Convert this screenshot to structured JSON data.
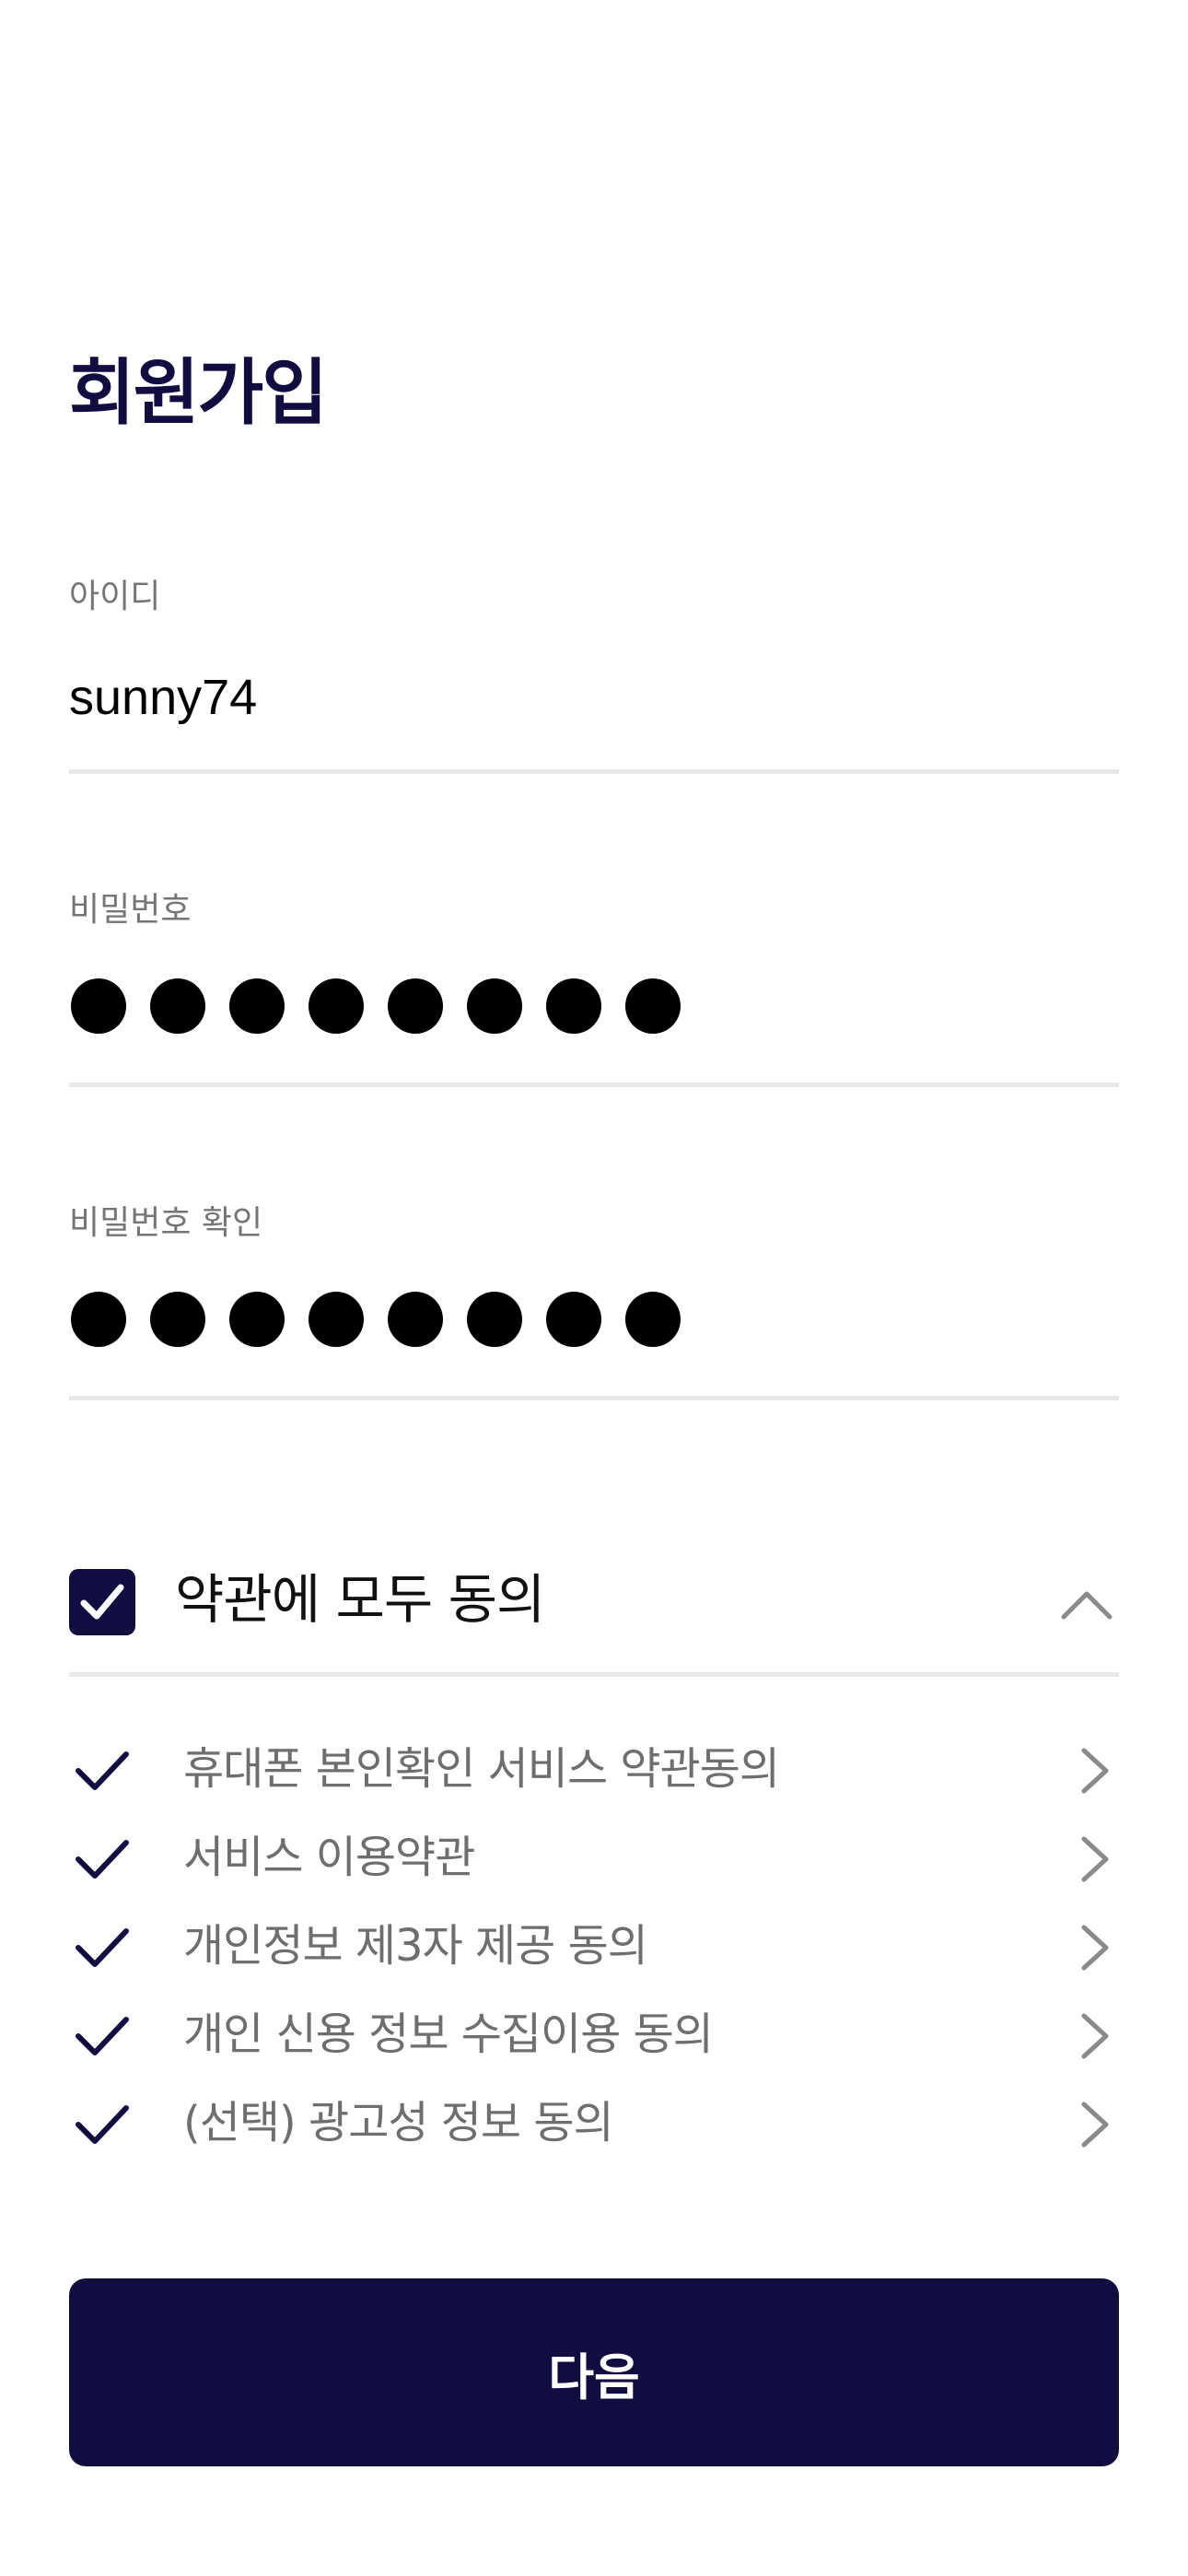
{
  "header": {
    "title": "회원가입"
  },
  "form": {
    "id": {
      "label": "아이디",
      "value": "sunny74"
    },
    "password": {
      "label": "비밀번호",
      "masked_length": 8
    },
    "password_confirm": {
      "label": "비밀번호 확인",
      "masked_length": 8
    }
  },
  "terms": {
    "agree_all_label": "약관에 모두 동의",
    "agree_all_checked": true,
    "expanded": true,
    "items": [
      {
        "label": "휴대폰 본인확인 서비스 약관동의",
        "checked": true
      },
      {
        "label": "서비스 이용약관",
        "checked": true
      },
      {
        "label": "개인정보 제3자 제공 동의",
        "checked": true
      },
      {
        "label": "개인 신용 정보 수집이용 동의",
        "checked": true
      },
      {
        "label": "(선택) 광고성 정보 동의",
        "checked": true
      }
    ]
  },
  "actions": {
    "next_label": "다음"
  },
  "colors": {
    "primary": "#120d40",
    "label_gray": "#757575",
    "divider": "#e8e8e8",
    "chevron_gray": "#8a8a8a"
  },
  "icons": {
    "checkbox": "checkmark-box-icon",
    "collapse": "chevron-up-icon",
    "term_check": "check-icon",
    "term_open": "chevron-right-icon"
  }
}
